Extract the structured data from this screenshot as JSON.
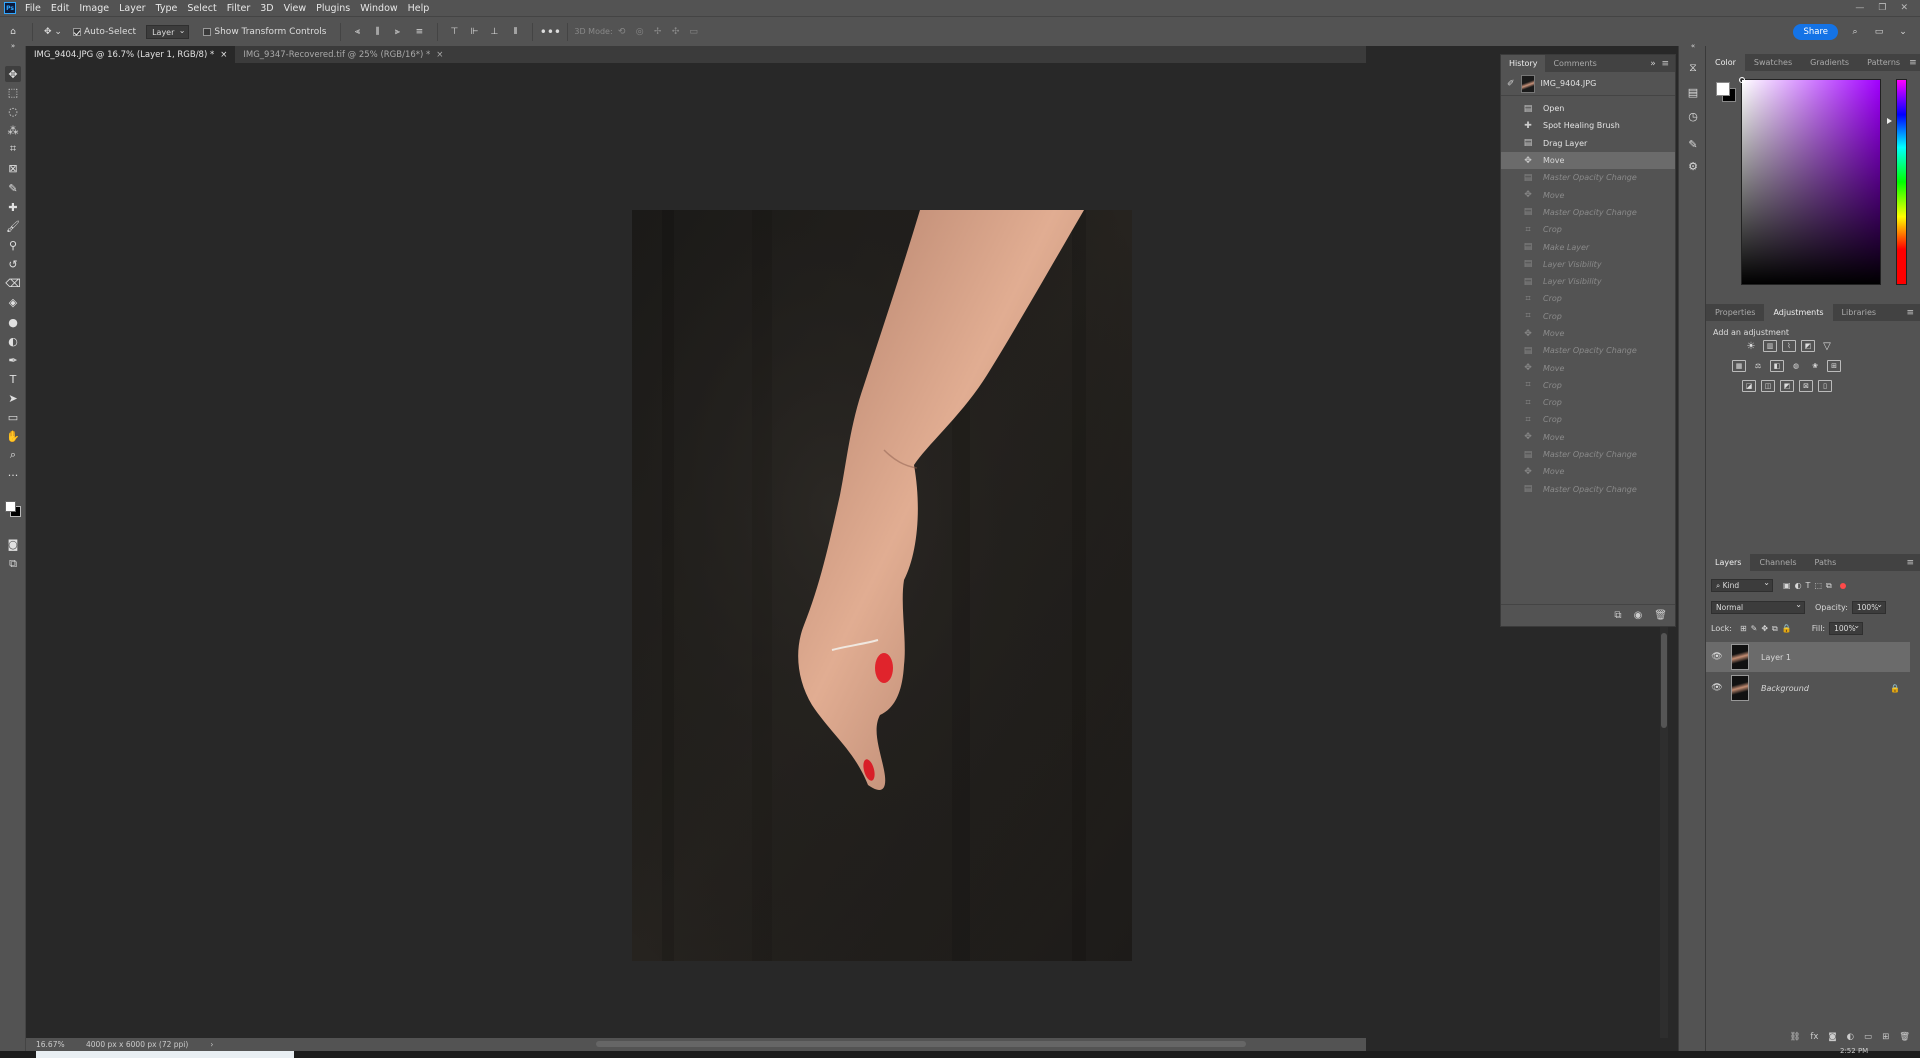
{
  "menubar": {
    "logo": "Ps",
    "items": [
      "File",
      "Edit",
      "Image",
      "Layer",
      "Type",
      "Select",
      "Filter",
      "3D",
      "View",
      "Plugins",
      "Window",
      "Help"
    ],
    "win_controls": [
      "—",
      "❐",
      "✕"
    ]
  },
  "options": {
    "auto_select_label": "Auto-Select",
    "auto_select_target": "Layer",
    "show_transform_label": "Show Transform Controls",
    "mode_3d_label": "3D Mode:",
    "share_label": "Share"
  },
  "tabs": [
    {
      "label": "IMG_9404.JPG @ 16.7% (Layer 1, RGB/8) *",
      "close": "×"
    },
    {
      "label": "IMG_9347-Recovered.tif @ 25% (RGB/16*) *",
      "close": "×"
    }
  ],
  "history": {
    "tabs": [
      "History",
      "Comments"
    ],
    "snapshot_name": "IMG_9404.JPG",
    "entries": [
      {
        "label": "Open",
        "icon": "document-icon",
        "state": "past"
      },
      {
        "label": "Spot Healing Brush",
        "icon": "healing-icon",
        "state": "past"
      },
      {
        "label": "Drag Layer",
        "icon": "document-icon",
        "state": "past"
      },
      {
        "label": "Move",
        "icon": "move-icon",
        "state": "current"
      },
      {
        "label": "Master Opacity Change",
        "icon": "document-icon",
        "state": "future"
      },
      {
        "label": "Move",
        "icon": "move-icon",
        "state": "future"
      },
      {
        "label": "Master Opacity Change",
        "icon": "document-icon",
        "state": "future"
      },
      {
        "label": "Crop",
        "icon": "crop-icon",
        "state": "future"
      },
      {
        "label": "Make Layer",
        "icon": "document-icon",
        "state": "future"
      },
      {
        "label": "Layer Visibility",
        "icon": "document-icon",
        "state": "future"
      },
      {
        "label": "Layer Visibility",
        "icon": "document-icon",
        "state": "future"
      },
      {
        "label": "Crop",
        "icon": "crop-icon",
        "state": "future"
      },
      {
        "label": "Crop",
        "icon": "crop-icon",
        "state": "future"
      },
      {
        "label": "Move",
        "icon": "move-icon",
        "state": "future"
      },
      {
        "label": "Master Opacity Change",
        "icon": "document-icon",
        "state": "future"
      },
      {
        "label": "Move",
        "icon": "move-icon",
        "state": "future"
      },
      {
        "label": "Crop",
        "icon": "crop-icon",
        "state": "future"
      },
      {
        "label": "Crop",
        "icon": "crop-icon",
        "state": "future"
      },
      {
        "label": "Crop",
        "icon": "crop-icon",
        "state": "future"
      },
      {
        "label": "Move",
        "icon": "move-icon",
        "state": "future"
      },
      {
        "label": "Master Opacity Change",
        "icon": "document-icon",
        "state": "future"
      },
      {
        "label": "Move",
        "icon": "move-icon",
        "state": "future"
      },
      {
        "label": "Master Opacity Change",
        "icon": "document-icon",
        "state": "future"
      }
    ]
  },
  "color_panel": {
    "tabs": [
      "Color",
      "Swatches",
      "Gradients",
      "Patterns"
    ],
    "foreground": "#ffffff",
    "background": "#000000"
  },
  "adjustments_panel": {
    "tabs": [
      "Properties",
      "Adjustments",
      "Libraries"
    ],
    "title": "Add an adjustment"
  },
  "layers_panel": {
    "tabs": [
      "Layers",
      "Channels",
      "Paths"
    ],
    "filter_kind": "Kind",
    "blend_mode": "Normal",
    "opacity_label": "Opacity:",
    "opacity_value": "100%",
    "lock_label": "Lock:",
    "fill_label": "Fill:",
    "fill_value": "100%",
    "layers": [
      {
        "name": "Layer 1",
        "selected": true,
        "locked": false
      },
      {
        "name": "Background",
        "selected": false,
        "locked": true
      }
    ]
  },
  "status": {
    "zoom": "16.67%",
    "doc_info": "4000 px x 6000 px (72 ppi)",
    "arrow": "›"
  },
  "taskbar": {
    "clock": "2:52 PM"
  },
  "colors": {
    "accent": "#1473e6",
    "panel_bg": "#535353",
    "canvas_bg": "#282828"
  }
}
